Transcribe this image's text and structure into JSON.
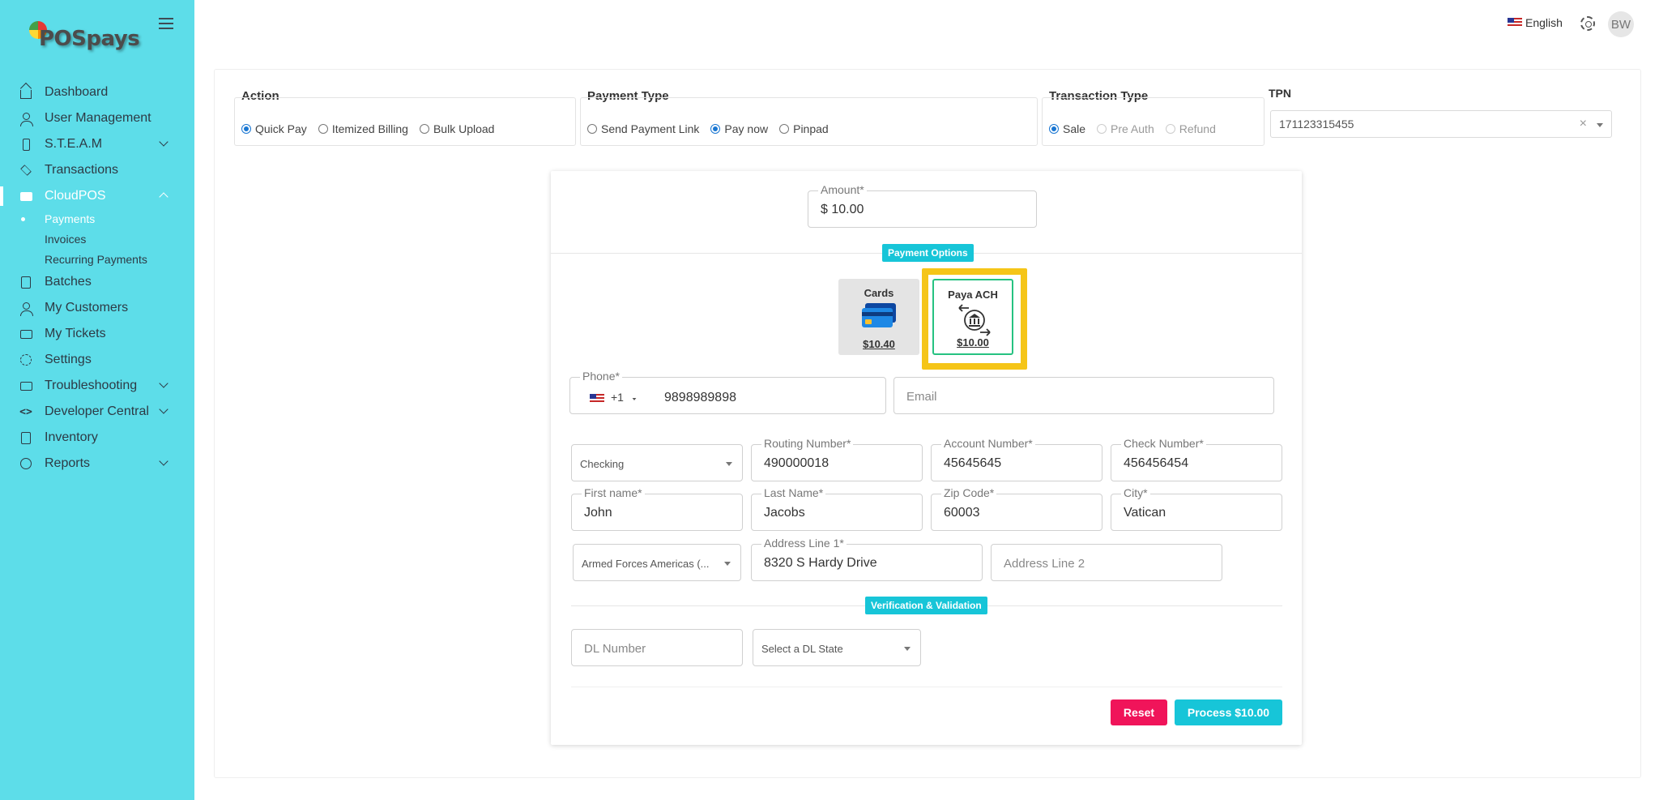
{
  "app": {
    "logo_text": "POSpays"
  },
  "sidebar": {
    "items": [
      {
        "label": "Dashboard"
      },
      {
        "label": "User Management"
      },
      {
        "label": "S.T.E.A.M"
      },
      {
        "label": "Transactions"
      },
      {
        "label": "CloudPOS"
      },
      {
        "label": "Batches"
      },
      {
        "label": "My Customers"
      },
      {
        "label": "My Tickets"
      },
      {
        "label": "Settings"
      },
      {
        "label": "Troubleshooting"
      },
      {
        "label": "Developer Central"
      },
      {
        "label": "Inventory"
      },
      {
        "label": "Reports"
      }
    ],
    "cloudpos_sub": [
      {
        "label": "Payments"
      },
      {
        "label": "Invoices"
      },
      {
        "label": "Recurring Payments"
      }
    ]
  },
  "topbar": {
    "language": "English",
    "avatar_initials": "BW"
  },
  "action": {
    "title": "Action",
    "options": [
      "Quick Pay",
      "Itemized Billing",
      "Bulk Upload"
    ],
    "selected": "Quick Pay"
  },
  "payment_type": {
    "title": "Payment Type",
    "options": [
      "Send Payment Link",
      "Pay now",
      "Pinpad"
    ],
    "selected": "Pay now"
  },
  "transaction_type": {
    "title": "Transaction Type",
    "options": [
      "Sale",
      "Pre Auth",
      "Refund"
    ],
    "selected": "Sale"
  },
  "tpn": {
    "title": "TPN",
    "value": "171123315455",
    "clear": "×"
  },
  "form": {
    "amount": {
      "label": "Amount*",
      "value": "$ 10.00"
    },
    "payment_options_label": "Payment Options",
    "options": [
      {
        "title": "Cards",
        "price": "$10.40"
      },
      {
        "title": "Paya ACH",
        "price": "$10.00"
      }
    ],
    "phone": {
      "label": "Phone*",
      "country_code": "+1",
      "value": "9898989898"
    },
    "email": {
      "placeholder": "Email"
    },
    "account_type": {
      "value": "Checking"
    },
    "routing_number": {
      "label": "Routing Number*",
      "value": "490000018"
    },
    "account_number": {
      "label": "Account Number*",
      "value": "45645645"
    },
    "check_number": {
      "label": "Check Number*",
      "value": "456456454"
    },
    "first_name": {
      "label": "First name*",
      "value": "John"
    },
    "last_name": {
      "label": "Last Name*",
      "value": "Jacobs"
    },
    "zip_code": {
      "label": "Zip Code*",
      "value": "60003"
    },
    "city": {
      "label": "City*",
      "value": "Vatican"
    },
    "state": {
      "value": "Armed Forces Americas (..."
    },
    "address1": {
      "label": "Address Line 1*",
      "value": "8320 S Hardy Drive"
    },
    "address2": {
      "placeholder": "Address Line 2"
    },
    "verification_label": "Verification & Validation",
    "dl_number": {
      "placeholder": "DL Number"
    },
    "dl_state": {
      "placeholder": "Select a DL State"
    },
    "reset_label": "Reset",
    "process_label": "Process $10.00"
  },
  "colors": {
    "sidebar_bg": "#5ddde9",
    "accent": "#17c5d8",
    "reset": "#f0145a",
    "highlight": "#f5c518"
  }
}
